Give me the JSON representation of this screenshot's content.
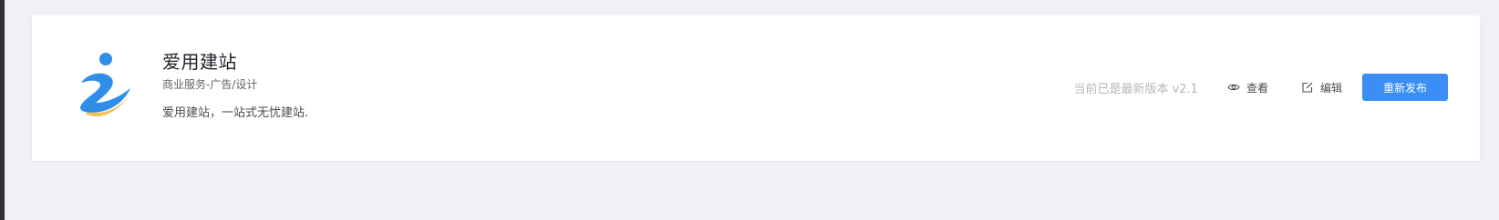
{
  "app": {
    "name": "爱用建站",
    "category": "商业服务-广告/设计",
    "description": "爱用建站，一站式无忧建站."
  },
  "actions": {
    "version_status": "当前已是最新版本 v2.1",
    "view_label": "查看",
    "edit_label": "编辑",
    "republish_label": "重新发布"
  },
  "icons": {
    "view": "eye-icon",
    "edit": "edit-icon",
    "logo": "app-logo"
  },
  "colors": {
    "primary": "#3a8ef6",
    "logo_blue": "#2e8ee8",
    "logo_yellow": "#f3c35a",
    "page_background": "#f0f1f6"
  }
}
